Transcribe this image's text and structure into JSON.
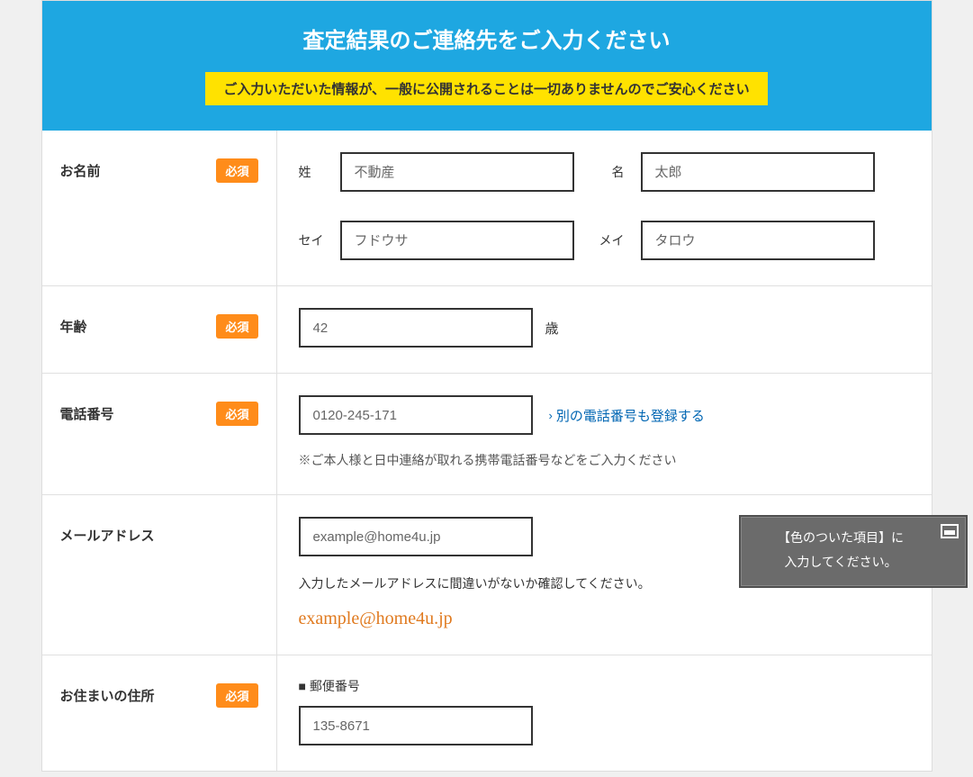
{
  "header": {
    "title": "査定結果のご連絡先をご入力ください",
    "notice": "ご入力いただいた情報が、一般に公開されることは一切ありませんのでご安心ください"
  },
  "badges": {
    "required": "必須"
  },
  "name": {
    "label": "お名前",
    "sei_label": "姓",
    "mei_label": "名",
    "sei_kana_label": "セイ",
    "mei_kana_label": "メイ",
    "sei_ph": "不動産",
    "mei_ph": "太郎",
    "sei_kana_ph": "フドウサ",
    "mei_kana_ph": "タロウ"
  },
  "age": {
    "label": "年齢",
    "ph": "42",
    "unit": "歳"
  },
  "phone": {
    "label": "電話番号",
    "ph": "0120-245-171",
    "add_link": "別の電話番号も登録する",
    "note": "※ご本人様と日中連絡が取れる携帯電話番号などをご入力ください"
  },
  "email": {
    "label": "メールアドレス",
    "ph": "example@home4u.jp",
    "confirm_note": "入力したメールアドレスに間違いがないか確認してください。",
    "echo": "example@home4u.jp"
  },
  "address": {
    "label": "お住まいの住所",
    "postal_label": "■ 郵便番号",
    "postal_ph": "135-8671"
  },
  "toast": {
    "line1": "【色のついた項目】に",
    "line2": "入力してください。"
  }
}
